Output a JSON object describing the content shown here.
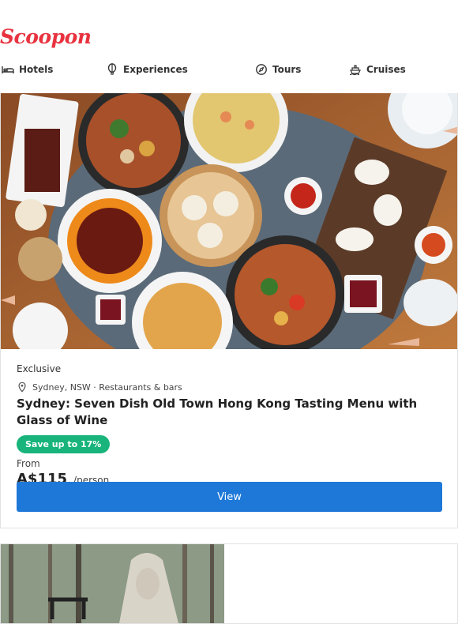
{
  "brand": {
    "name": "Scoopon",
    "color": "#e8333f"
  },
  "nav": {
    "items": [
      {
        "label": "Hotels",
        "icon": "bed-icon"
      },
      {
        "label": "Experiences",
        "icon": "balloon-icon"
      },
      {
        "label": "Tours",
        "icon": "compass-icon"
      },
      {
        "label": "Cruises",
        "icon": "ship-icon"
      }
    ]
  },
  "deal": {
    "image_alt": "Table of Chinese dishes",
    "tag": "Exclusive",
    "location": "Sydney, NSW · Restaurants & bars",
    "title": "Sydney: Seven Dish Old Town Hong Kong Tasting Menu with Glass of Wine",
    "savings": "Save up to 17%",
    "from_label": "From",
    "price": "A$115",
    "per": "/person",
    "cta": "View",
    "colors": {
      "savings_bg": "#18b47b",
      "cta_bg": "#1e78d8"
    }
  },
  "next_deal": {
    "image_alt": "Sphinx statue in forest"
  }
}
